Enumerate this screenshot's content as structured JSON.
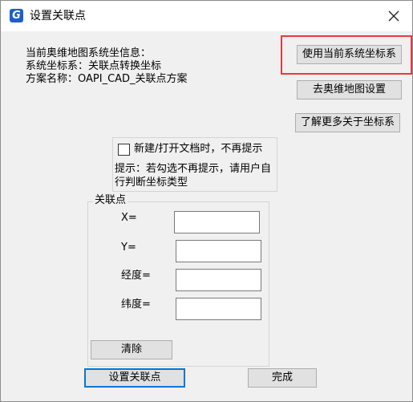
{
  "window": {
    "title": "设置关联点",
    "app_icon_glyph": "G",
    "close_icon": "close-icon"
  },
  "info": {
    "line1": "当前奥维地图系统坐信息：",
    "line2": "系统坐标系：关联点转换坐标",
    "line3": "方案名称：OAPI_CAD_关联点方案"
  },
  "buttons": {
    "use_current": "使用当前系统坐标系",
    "goto_settings": "去奥维地图设置",
    "learn_more": "了解更多关于坐标系",
    "clear": "清除",
    "set_point": "设置关联点",
    "done": "完成"
  },
  "notify": {
    "checkbox_label": "新建/打开文档时，不再提示",
    "checked": false,
    "hint": "提示：若勾选不再提示，请用户自行判断坐标类型"
  },
  "group": {
    "legend": "关联点",
    "fields": [
      {
        "label": "X=",
        "value": ""
      },
      {
        "label": "Y=",
        "value": ""
      },
      {
        "label": "经度=",
        "value": ""
      },
      {
        "label": "纬度=",
        "value": ""
      }
    ]
  },
  "colors": {
    "highlight": "#e8393d",
    "app_icon": "#1f5fc7"
  }
}
